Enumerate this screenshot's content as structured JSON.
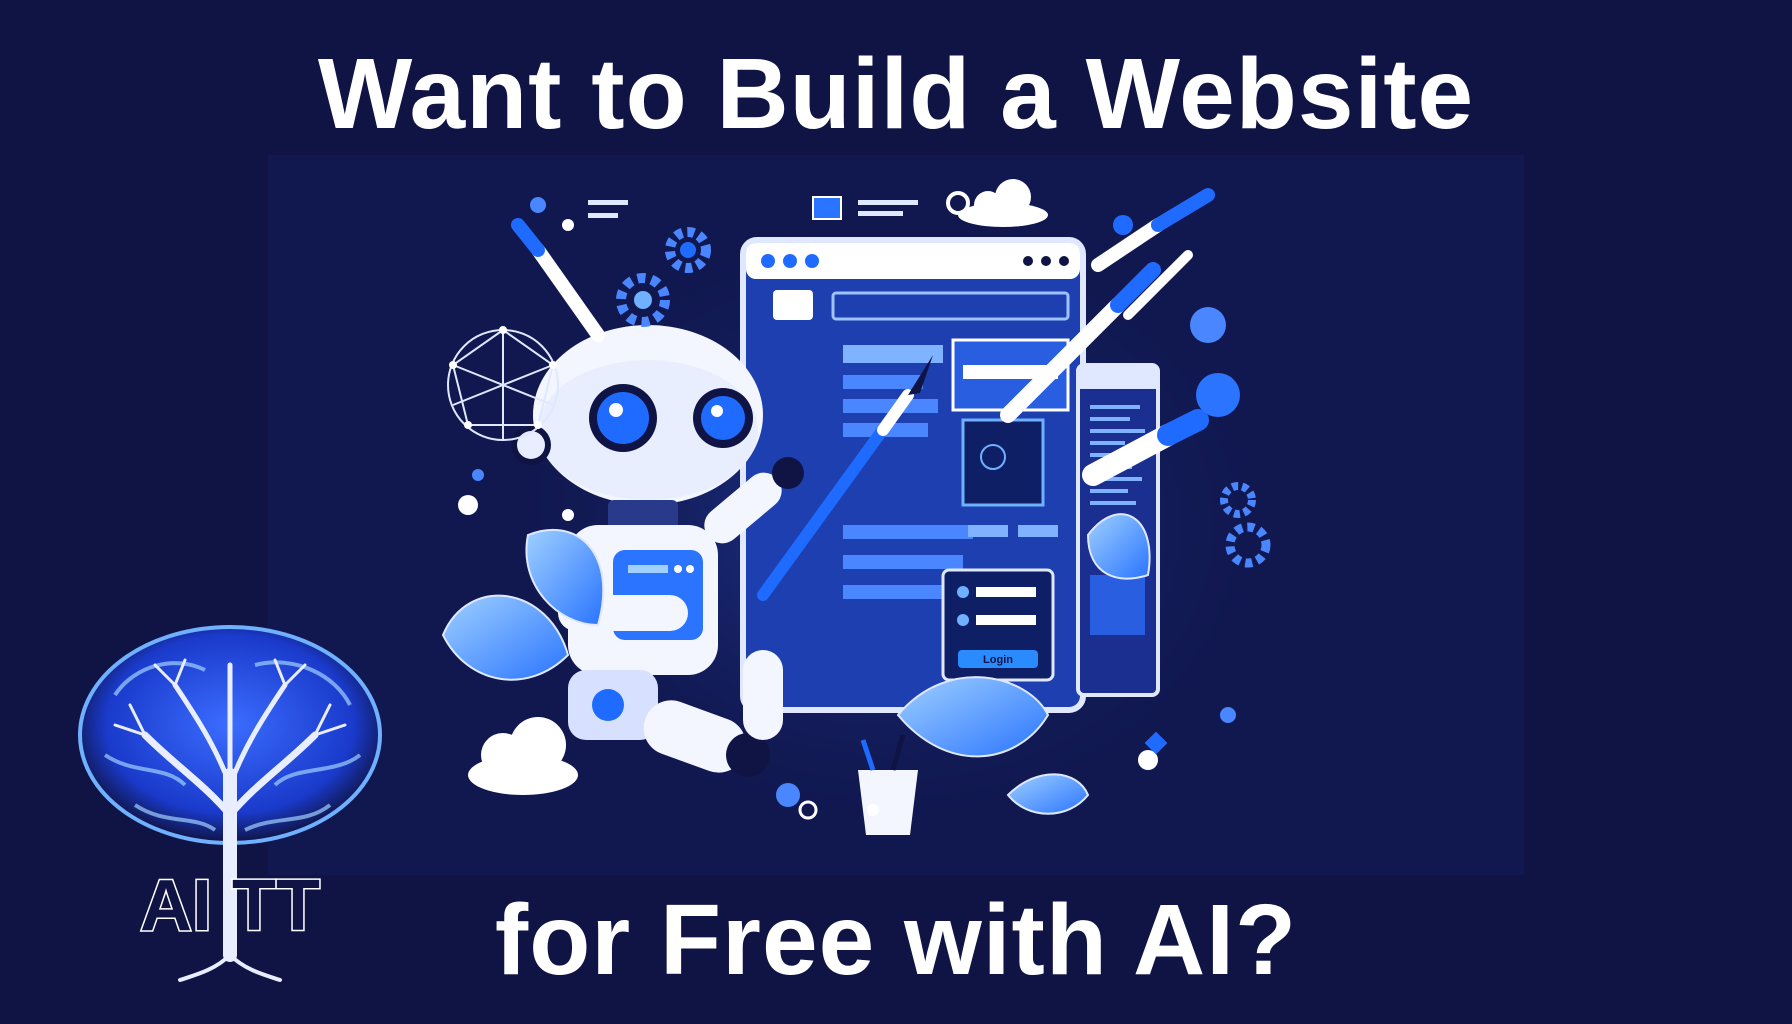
{
  "headline": {
    "top": "Want to Build a Website",
    "bottom": "for Free with AI?"
  },
  "illustration": {
    "login_button_label": "Login"
  },
  "logo": {
    "text": "AI TT"
  },
  "colors": {
    "background": "#0f1444",
    "accent_blue": "#1f6bff",
    "light_blue": "#6fb0ff",
    "white": "#ffffff"
  }
}
